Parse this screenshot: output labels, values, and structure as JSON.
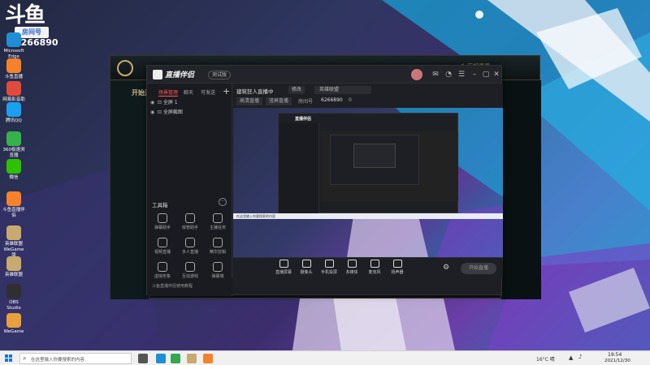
{
  "overlay": {
    "logo_text": "斗鱼",
    "room_badge": "房间号",
    "room_number": "6266890"
  },
  "desktop_icons": [
    {
      "label": "Microsoft Edge",
      "icon": "edge-icon",
      "color": "#1e8fd6"
    },
    {
      "label": "斗鱼直播",
      "icon": "douyu-icon",
      "color": "#f5822a"
    },
    {
      "label": "网易影音助手",
      "icon": "netease-icon",
      "color": "#e24a3b"
    },
    {
      "label": "腾讯QQ",
      "icon": "qq-icon",
      "color": "#1aa0f0"
    },
    {
      "label": "360极速浏览器",
      "icon": "browser-icon",
      "color": "#35b34a"
    },
    {
      "label": "微信",
      "icon": "wechat-icon",
      "color": "#2dc100"
    },
    {
      "label": "斗鱼直播伴侣",
      "icon": "douyu-companion-icon",
      "color": "#f5822a"
    },
    {
      "label": "英雄联盟WeGame版",
      "icon": "lol-icon",
      "color": "#c8aa6e"
    },
    {
      "label": "英雄联盟",
      "icon": "lol-icon",
      "color": "#c8aa6e"
    },
    {
      "label": "OBS Studio",
      "icon": "obs-icon",
      "color": "#302e31"
    },
    {
      "label": "WeGame",
      "icon": "wegame-icon",
      "color": "#e8a13a"
    }
  ],
  "lol_client": {
    "side_label": "开始游戏",
    "right_label": "斗 互相看看"
  },
  "app": {
    "title": "直播伴侣",
    "version": "测试版",
    "scene_tabs": [
      "场景管理",
      "聊天",
      "可发送"
    ],
    "sources": [
      "全屏 1",
      "全屏截图"
    ],
    "toolbox_label": "工具箱",
    "toolbox_more": "···",
    "tools": [
      {
        "label": "弹幕助手",
        "icon": "danmaku-icon"
      },
      {
        "label": "房管助手",
        "icon": "admin-icon"
      },
      {
        "label": "主播任务",
        "icon": "task-icon"
      },
      {
        "label": "视频直播",
        "icon": "video-icon"
      },
      {
        "label": "多人直播",
        "icon": "multi-icon"
      },
      {
        "label": "精华剪辑",
        "icon": "clip-icon"
      },
      {
        "label": "虚拟形象",
        "icon": "avatar-icon"
      },
      {
        "label": "互动游戏",
        "icon": "game-icon"
      },
      {
        "label": "弹幕墙",
        "icon": "wall-icon"
      }
    ],
    "notice": "斗鱼直播伴侣使用教程",
    "header": {
      "stream_title": "建筑狂人直播中",
      "edit": "修改",
      "category": "英雄联盟",
      "status": "高清直播",
      "mode": "竖屏直播",
      "room_label": "房间号",
      "room_id": "6266890",
      "viewers": "0"
    },
    "controls": [
      {
        "label": "直播屏幕",
        "icon": "screen-icon"
      },
      {
        "label": "摄像头",
        "icon": "camera-icon"
      },
      {
        "label": "手机投屏",
        "icon": "phone-icon"
      },
      {
        "label": "多媒体",
        "icon": "media-icon"
      },
      {
        "label": "麦克风",
        "icon": "mic-icon"
      },
      {
        "label": "扬声器",
        "icon": "speaker-icon"
      }
    ],
    "start_button": "开始直播",
    "nested_search": "在这里输入你要搜索的内容"
  },
  "taskbar": {
    "search_placeholder": "在这里输入你要搜索的内容",
    "temperature": "16°C 晴",
    "time": "19:54",
    "date": "2021/12/30",
    "apps": [
      {
        "icon": "task-view-icon",
        "color": "#555"
      },
      {
        "icon": "edge-icon",
        "color": "#1e8fd6"
      },
      {
        "icon": "chrome-icon",
        "color": "#34a853"
      },
      {
        "icon": "lol-icon",
        "color": "#c8aa6e"
      },
      {
        "icon": "douyu-icon",
        "color": "#f5822a"
      }
    ]
  }
}
